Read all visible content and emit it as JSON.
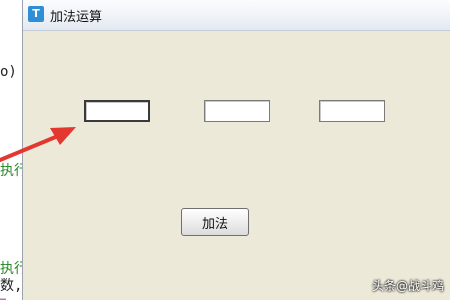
{
  "background_code": {
    "paren": "o)",
    "exec_1": "执行",
    "exec_2": "执行",
    "num": "数,",
    "fragment": "…"
  },
  "window": {
    "title": "加法运算",
    "icon_glyph": "T"
  },
  "fields": [
    {
      "value": "",
      "placeholder": ""
    },
    {
      "value": "",
      "placeholder": ""
    },
    {
      "value": "",
      "placeholder": ""
    }
  ],
  "buttons": {
    "add_label": "加法"
  },
  "watermark": "头条@战斗鸡",
  "colors": {
    "annotation_arrow": "#e2382f",
    "window_bg": "#ece9d8",
    "title_icon": "#2f8fd6"
  }
}
